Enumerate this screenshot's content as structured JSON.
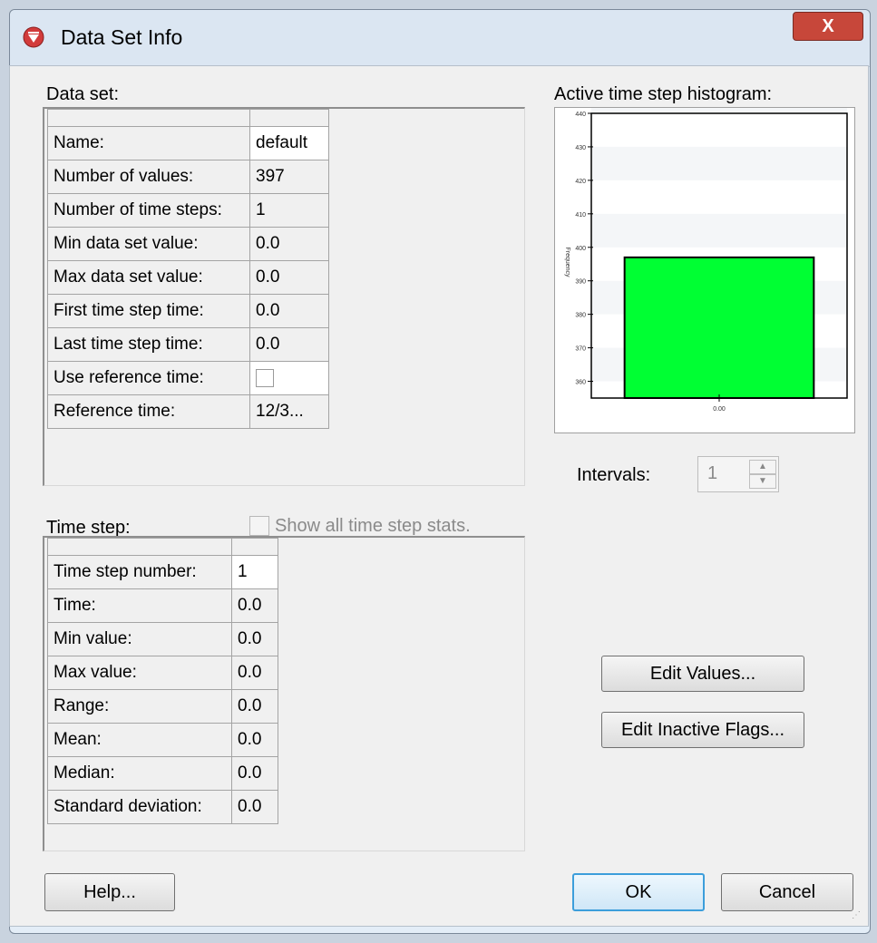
{
  "window": {
    "title": "Data Set Info",
    "close_label": "X"
  },
  "dataset": {
    "label": "Data set:",
    "rows": [
      {
        "label": "Name:",
        "value": "default"
      },
      {
        "label": "Number of values:",
        "value": "397"
      },
      {
        "label": "Number of time steps:",
        "value": "1"
      },
      {
        "label": "Min data set value:",
        "value": "0.0"
      },
      {
        "label": "Max data set value:",
        "value": "0.0"
      },
      {
        "label": "First time step time:",
        "value": "0.0"
      },
      {
        "label": "Last time step time:",
        "value": "0.0"
      },
      {
        "label": "Use reference time:",
        "value": ""
      },
      {
        "label": "Reference time:",
        "value": "12/3..."
      }
    ]
  },
  "timestep": {
    "label": "Time step:",
    "show_all_label": "Show all time step stats.",
    "rows": [
      {
        "label": "Time step number:",
        "value": "1"
      },
      {
        "label": "Time:",
        "value": "0.0"
      },
      {
        "label": "Min value:",
        "value": "0.0"
      },
      {
        "label": "Max value:",
        "value": "0.0"
      },
      {
        "label": "Range:",
        "value": "0.0"
      },
      {
        "label": "Mean:",
        "value": "0.0"
      },
      {
        "label": "Median:",
        "value": "0.0"
      },
      {
        "label": "Standard deviation:",
        "value": "0.0"
      }
    ]
  },
  "histogram": {
    "label": "Active time step histogram:",
    "intervals_label": "Intervals:",
    "intervals_value": "1"
  },
  "chart_data": {
    "type": "bar",
    "categories": [
      "0.00"
    ],
    "values": [
      397
    ],
    "ylabel": "Frequency",
    "ylim": [
      355,
      440
    ],
    "yticks": [
      360,
      370,
      380,
      390,
      400,
      410,
      420,
      430,
      440
    ],
    "bar_color": "#00ff33"
  },
  "buttons": {
    "edit_values": "Edit Values...",
    "edit_inactive": "Edit Inactive Flags...",
    "help": "Help...",
    "ok": "OK",
    "cancel": "Cancel"
  },
  "colors": {
    "accent": "#3c9edb",
    "close": "#c7473a"
  }
}
